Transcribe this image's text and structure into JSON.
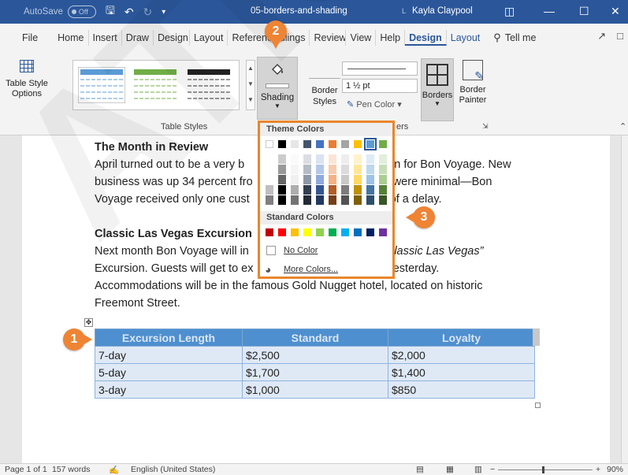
{
  "titlebar": {
    "autosave_label": "AutoSave",
    "autosave_state": "Off",
    "filename": "05-borders-and-shading",
    "user_name": "Kayla Claypool",
    "user_initial": "L"
  },
  "tabs": [
    "File",
    "Home",
    "Insert",
    "Draw",
    "Design",
    "Layout",
    "References",
    "Mailings",
    "Review",
    "View",
    "Help",
    "Design",
    "Layout"
  ],
  "tell_me": "Tell me",
  "ribbon": {
    "table_style_options": "Table Style Options",
    "table_styles_label": "Table Styles",
    "shading_label": "Shading",
    "border_styles_label_1": "Border",
    "border_styles_label_2": "Styles",
    "pen_weight": "1 ½ pt",
    "pen_color_label": "Pen Color",
    "borders_label": "Borders",
    "border_painter_label_1": "Border",
    "border_painter_label_2": "Painter",
    "borders_group_label": "ers"
  },
  "shading_menu": {
    "theme_colors_label": "Theme Colors",
    "standard_colors_label": "Standard Colors",
    "no_color_label": "No Color",
    "more_colors_label": "More Colors...",
    "theme_top_row": [
      "#ffffff",
      "#000000",
      "#e7e6e6",
      "#44546a",
      "#4472c4",
      "#ed7d31",
      "#a5a5a5",
      "#ffc000",
      "#5b9bd5",
      "#70ad47"
    ],
    "standard_colors": [
      "#c00000",
      "#ff0000",
      "#ffc000",
      "#ffff00",
      "#92d050",
      "#00b050",
      "#00b0f0",
      "#0070c0",
      "#002060",
      "#7030a0"
    ],
    "selected_index": 8
  },
  "document": {
    "heading1": "The Month in Review",
    "p1_l1a": "April turned out to be a very b",
    "p1_l1b": "n for Bon Voyage. New",
    "p1_l2a": "business was up 34 percent fro",
    "p1_l2b": "were minimal—Bon",
    "p1_l3a": "Voyage received only one cust",
    "p1_l3b": "of a delay.",
    "heading2": "Classic Las Vegas Excursion",
    "p2_l1a": "Next month Bon Voyage will in",
    "p2_l1b": "Classic Las Vegas”",
    "p2_l2a": "Excursion. Guests will get to ex",
    "p2_l2b": "yesterday.",
    "p2_l3": "Accommodations will be in the famous Gold Nugget hotel, located on historic",
    "p2_l4": "Freemont Street."
  },
  "table": {
    "headers": [
      "Excursion Length",
      "Standard",
      "Loyalty"
    ],
    "rows": [
      [
        "7-day",
        "$2,500",
        "$2,000"
      ],
      [
        "5-day",
        "$1,700",
        "$1,400"
      ],
      [
        "3-day",
        "$1,000",
        "$850"
      ]
    ]
  },
  "callouts": [
    "1",
    "2",
    "3"
  ],
  "status": {
    "page": "Page 1 of 1",
    "words": "157 words",
    "language": "English (United States)",
    "zoom": "90%"
  },
  "watermark": "ATION"
}
